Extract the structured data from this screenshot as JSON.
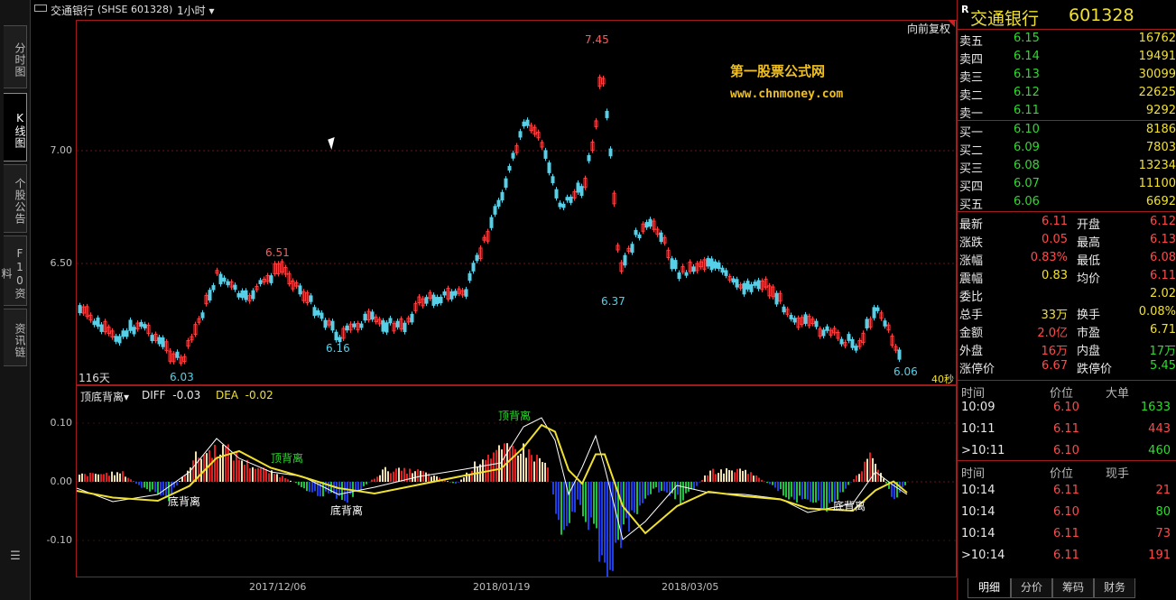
{
  "sidebar": {
    "tabs": [
      {
        "label": "分时图"
      },
      {
        "label": "K线图"
      },
      {
        "label": "个股公告"
      },
      {
        "label": "F10资料"
      },
      {
        "label": "资讯链"
      }
    ]
  },
  "titlebar": {
    "name": "交通银行",
    "code": "(SHSE 601328)",
    "period": "1小时"
  },
  "main_chart": {
    "restore_label": "向前复权",
    "period_count": "116天",
    "countdown": "40秒",
    "y_ticks": [
      "7.00",
      "6.50"
    ],
    "watermark": [
      "第一股票公式网",
      "www.chnmoney.com"
    ],
    "annotations": {
      "high": "7.45",
      "l1": "6.03",
      "h1": "6.51",
      "l2": "6.16",
      "l3": "6.37",
      "l4": "6.06"
    }
  },
  "macd": {
    "indicator": "顶底背离",
    "diff_label": "DIFF",
    "diff_value": "-0.03",
    "dea_label": "DEA",
    "dea_value": "-0.02",
    "y_ticks": [
      "0.10",
      "0.00",
      "-0.10"
    ],
    "signals": {
      "top1": "顶背离",
      "top2": "顶背离",
      "bot1": "底背离",
      "bot2": "底背离",
      "bot3": "底背离"
    }
  },
  "x_dates": [
    "2017/12/06",
    "2018/01/19",
    "2018/03/05"
  ],
  "quote": {
    "r_mark": "R",
    "name": "交通银行",
    "code": "601328",
    "asks": [
      {
        "label": "卖五",
        "price": "6.15",
        "vol": "16762"
      },
      {
        "label": "卖四",
        "price": "6.14",
        "vol": "19491"
      },
      {
        "label": "卖三",
        "price": "6.13",
        "vol": "30099"
      },
      {
        "label": "卖二",
        "price": "6.12",
        "vol": "22625"
      },
      {
        "label": "卖一",
        "price": "6.11",
        "vol": "9292"
      }
    ],
    "bids": [
      {
        "label": "买一",
        "price": "6.10",
        "vol": "8186"
      },
      {
        "label": "买二",
        "price": "6.09",
        "vol": "7803"
      },
      {
        "label": "买三",
        "price": "6.08",
        "vol": "13234"
      },
      {
        "label": "买四",
        "price": "6.07",
        "vol": "11100"
      },
      {
        "label": "买五",
        "price": "6.06",
        "vol": "6692"
      }
    ],
    "stats": [
      {
        "l1": "最新",
        "v1": "6.11",
        "l2": "开盘",
        "v2": "6.12"
      },
      {
        "l1": "涨跌",
        "v1": "0.05",
        "l2": "最高",
        "v2": "6.13"
      },
      {
        "l1": "涨幅",
        "v1": "0.83%",
        "l2": "最低",
        "v2": "6.08"
      },
      {
        "l1": "震幅",
        "v1": "0.83",
        "l2": "均价",
        "v2": "6.11"
      },
      {
        "l1": "委比",
        "v1": "",
        "l2": "",
        "v2": "2.02"
      },
      {
        "l1": "总手",
        "v1": "33万",
        "l2": "换手",
        "v2": "0.08%"
      },
      {
        "l1": "金额",
        "v1": "2.0亿",
        "l2": "市盈",
        "v2": "6.71"
      },
      {
        "l1": "外盘",
        "v1": "16万",
        "l2": "内盘",
        "v2": "17万"
      },
      {
        "l1": "涨停价",
        "v1": "6.67",
        "l2": "跌停价",
        "v2": "5.45"
      }
    ],
    "big_orders": {
      "h1": "时间",
      "h2": "价位",
      "h3": "大单",
      "rows": [
        {
          "t": "10:09",
          "p": "6.10",
          "v": "1633"
        },
        {
          "t": "10:11",
          "p": "6.11",
          "v": "443"
        },
        {
          "t": ">10:11",
          "p": "6.10",
          "v": "460"
        }
      ]
    },
    "ticks": {
      "h1": "时间",
      "h2": "价位",
      "h3": "现手",
      "rows": [
        {
          "t": "10:14",
          "p": "6.11",
          "v": "21"
        },
        {
          "t": "10:14",
          "p": "6.10",
          "v": "80"
        },
        {
          "t": "10:14",
          "p": "6.11",
          "v": "73"
        },
        {
          "t": ">10:14",
          "p": "6.11",
          "v": "191"
        }
      ]
    },
    "bottom_tabs": [
      "明细",
      "分价",
      "筹码",
      "财务"
    ]
  }
}
